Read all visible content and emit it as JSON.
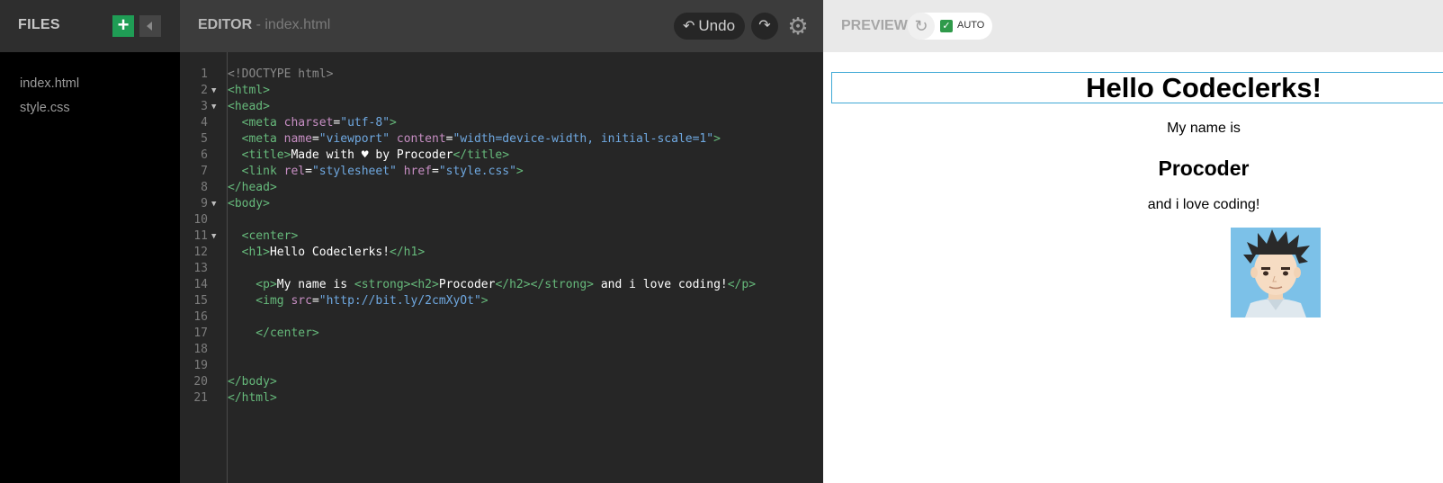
{
  "files_pane": {
    "title": "FILES",
    "add_label": "+",
    "files": [
      "index.html",
      "style.css"
    ]
  },
  "editor_pane": {
    "title": "EDITOR",
    "filename": " - index.html",
    "undo_label": "Undo",
    "lines": [
      {
        "n": "1",
        "fold": false
      },
      {
        "n": "2",
        "fold": true
      },
      {
        "n": "3",
        "fold": true
      },
      {
        "n": "4",
        "fold": false
      },
      {
        "n": "5",
        "fold": false
      },
      {
        "n": "6",
        "fold": false
      },
      {
        "n": "7",
        "fold": false
      },
      {
        "n": "8",
        "fold": false
      },
      {
        "n": "9",
        "fold": true
      },
      {
        "n": "10",
        "fold": false
      },
      {
        "n": "11",
        "fold": true
      },
      {
        "n": "12",
        "fold": false
      },
      {
        "n": "13",
        "fold": false
      },
      {
        "n": "14",
        "fold": false
      },
      {
        "n": "15",
        "fold": false
      },
      {
        "n": "16",
        "fold": false
      },
      {
        "n": "17",
        "fold": false
      },
      {
        "n": "18",
        "fold": false
      },
      {
        "n": "19",
        "fold": false
      },
      {
        "n": "20",
        "fold": false
      },
      {
        "n": "21",
        "fold": false
      }
    ],
    "code": {
      "l1": "<!DOCTYPE html>",
      "l2": "<html>",
      "l3": "<head>",
      "l4_open": "  <meta ",
      "l4_attr": "charset",
      "l4_eq": "=",
      "l4_val": "\"utf-8\"",
      "l4_close": ">",
      "l5_open": "  <meta ",
      "l5_attr1": "name",
      "l5_eq1": "=",
      "l5_val1": "\"viewport\"",
      "l5_sp": " ",
      "l5_attr2": "content",
      "l5_eq2": "=",
      "l5_val2": "\"width=device-width, initial-scale=1\"",
      "l5_close": ">",
      "l6_open": "  <title>",
      "l6_text": "Made with ♥ by Procoder",
      "l6_close": "</title>",
      "l7_open": "  <link ",
      "l7_attr1": "rel",
      "l7_eq1": "=",
      "l7_val1": "\"stylesheet\"",
      "l7_sp": " ",
      "l7_attr2": "href",
      "l7_eq2": "=",
      "l7_val2": "\"style.css\"",
      "l7_close": ">",
      "l8": "</head>",
      "l9": "<body>",
      "l11": "  <center>",
      "l12_open": "  <h1>",
      "l12_text": "Hello Codeclerks!",
      "l12_close": "</h1>",
      "l14_p": "    <p>",
      "l14_t1": "My name is ",
      "l14_strong": "<strong><h2>",
      "l14_t2": "Procoder",
      "l14_close": "</h2></strong>",
      "l14_t3": " and i love coding!",
      "l14_pclose": "</p>",
      "l15_open": "    <img ",
      "l15_attr": "src",
      "l15_eq": "=",
      "l15_val": "\"http://bit.ly/2cmXyOt\"",
      "l15_close": ">",
      "l17": "    </center>",
      "l20": "</body>",
      "l21": "</html>"
    }
  },
  "preview_pane": {
    "title": "PREVIEW",
    "auto_label": "AUTO",
    "auto_checked": true,
    "h1": "Hello Codeclerks!",
    "p1": "My name is",
    "h2": "Procoder",
    "p2": "and i love coding!"
  }
}
